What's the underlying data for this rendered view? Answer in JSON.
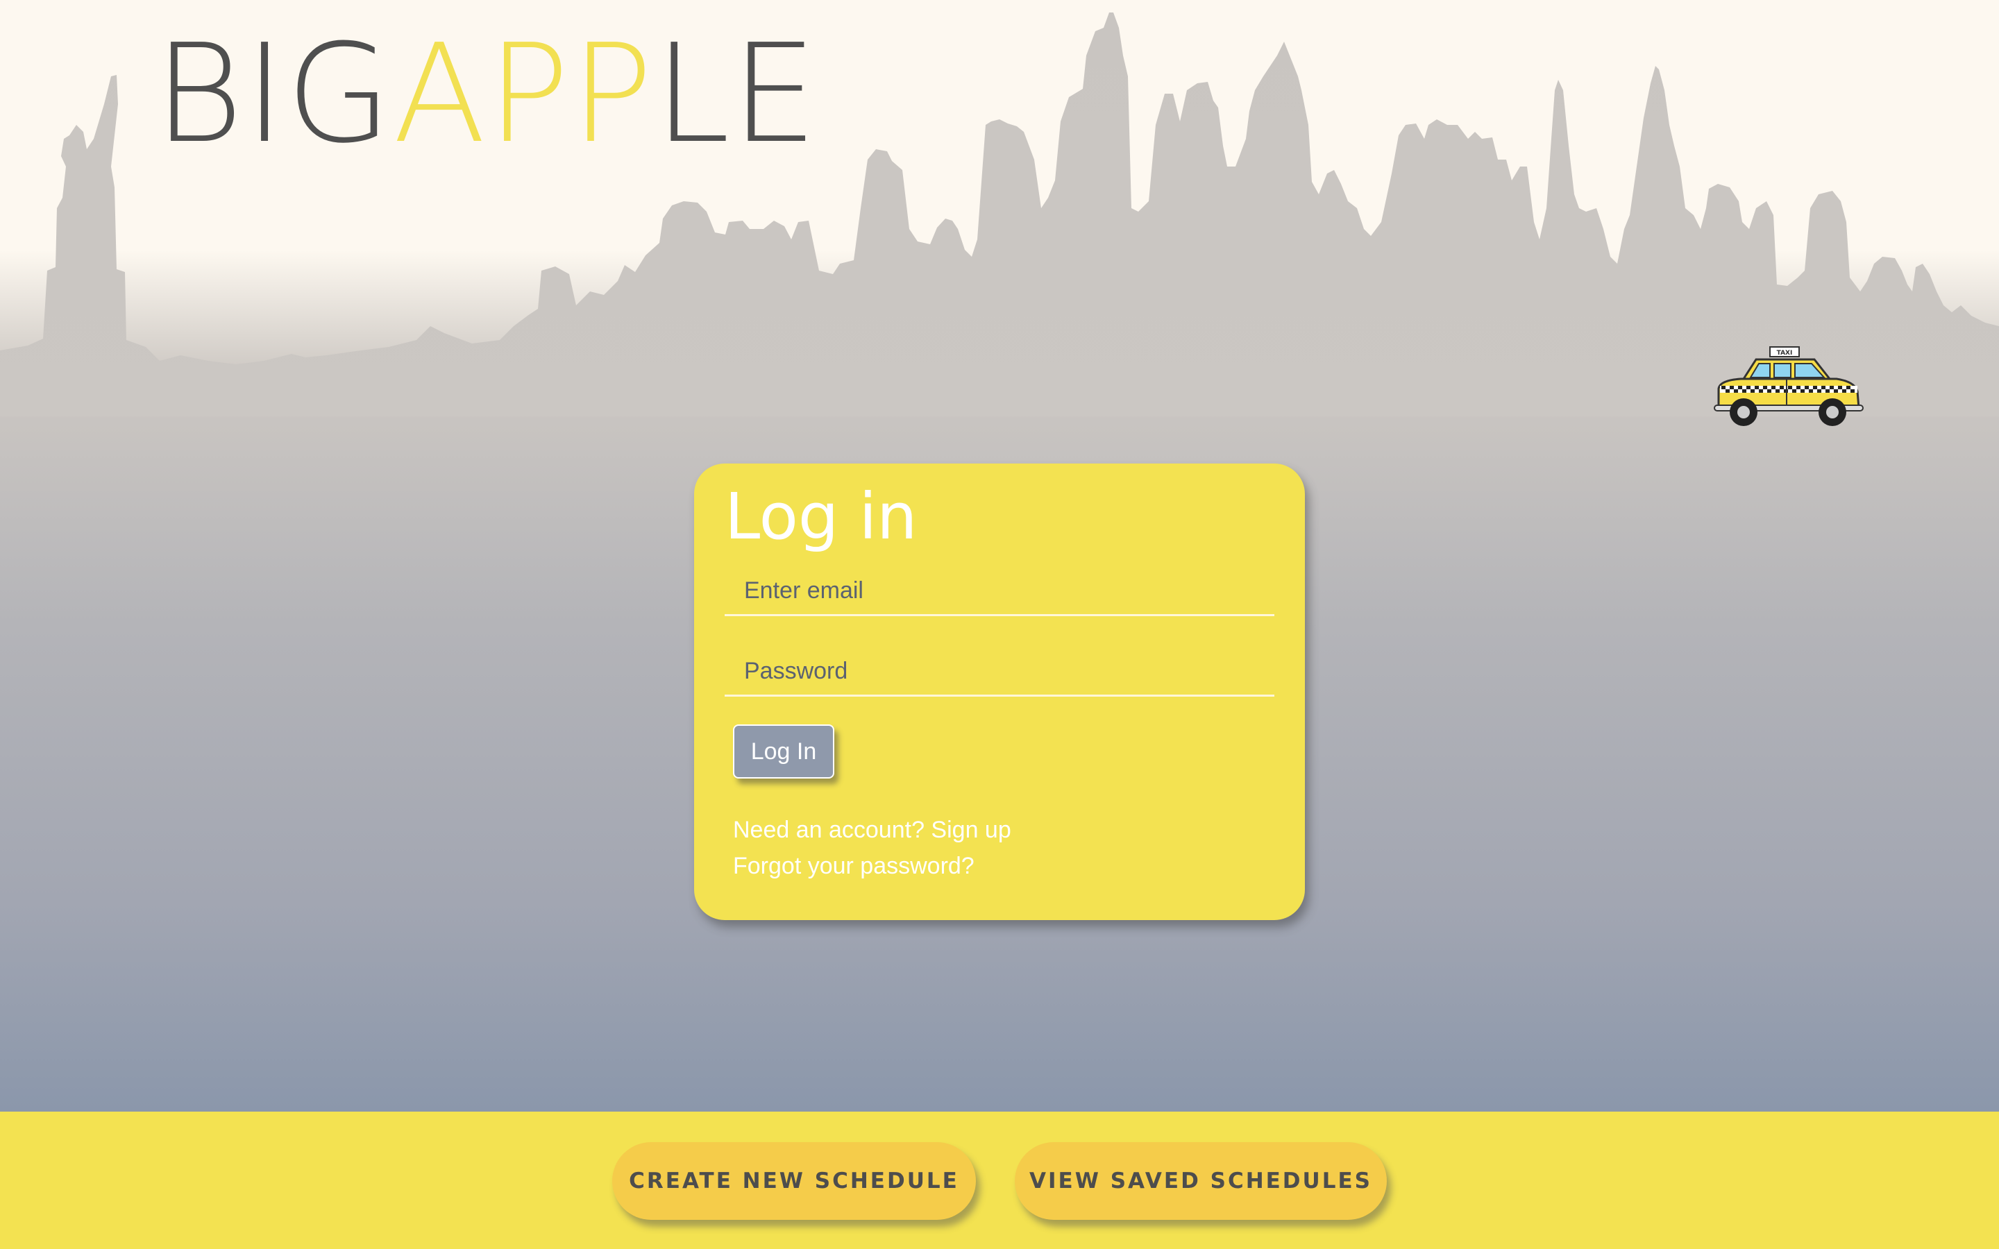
{
  "logo": {
    "part1": "BIG",
    "part2": "APP",
    "part3": "LE"
  },
  "colors": {
    "accent": "#f3e251",
    "text_dark": "#4f4f4f",
    "button_gray": "#8f99ab",
    "footer_button": "#f5cc4a"
  },
  "icons": {
    "skyline": "new-york-skyline-silhouette",
    "taxi": "taxi-cab-illustration"
  },
  "login": {
    "title": "Log in",
    "email_placeholder": "Enter email",
    "email_value": "",
    "password_placeholder": "Password",
    "password_value": "",
    "submit_label": "Log In",
    "signup_link": "Need an account? Sign up",
    "forgot_link": "Forgot your password?"
  },
  "taxi_sign": "TAXI",
  "footer": {
    "create_label": "CREATE NEW SCHEDULE",
    "view_label": "VIEW SAVED SCHEDULES"
  }
}
